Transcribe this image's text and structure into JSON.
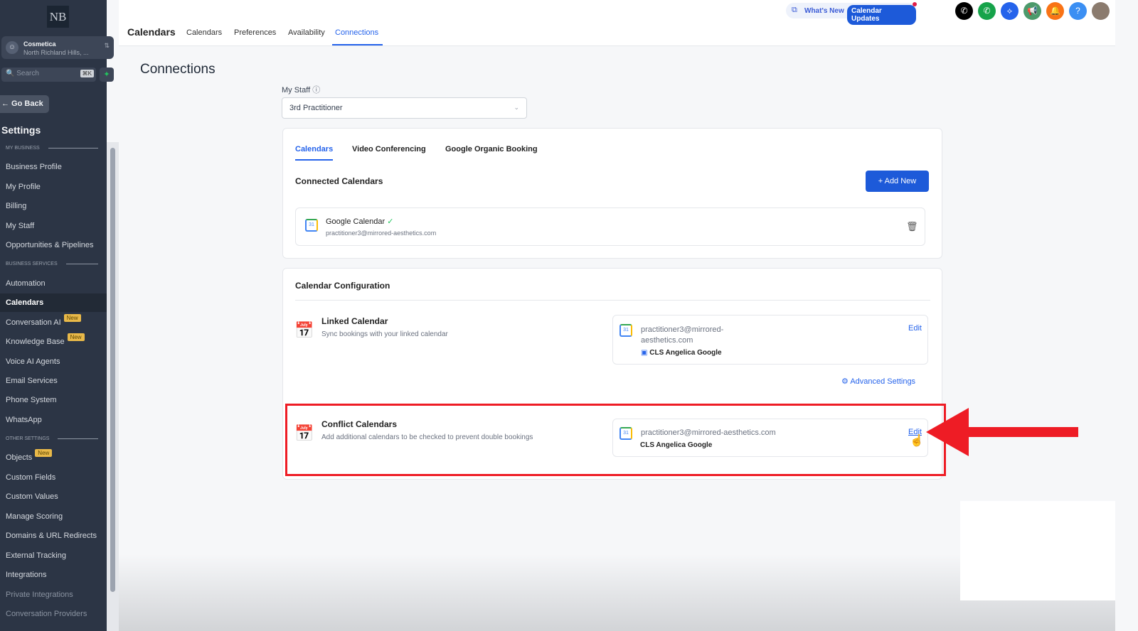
{
  "sidebar": {
    "logo": "NB",
    "account_name": "Cosmetica",
    "account_location": "North Richland Hills, ...",
    "search_placeholder": "Search",
    "search_shortcut": "⌘K",
    "go_back": "← Go Back",
    "settings_title": "Settings",
    "sections": {
      "my_business": "MY BUSINESS",
      "business_services": "BUSINESS SERVICES",
      "other_settings": "OTHER SETTINGS"
    },
    "items": [
      "Business Profile",
      "My Profile",
      "Billing",
      "My Staff",
      "Opportunities & Pipelines",
      "Automation",
      "Calendars",
      "Conversation AI",
      "Knowledge Base",
      "Voice AI Agents",
      "Email Services",
      "Phone System",
      "WhatsApp",
      "Objects",
      "Custom Fields",
      "Custom Values",
      "Manage Scoring",
      "Domains & URL Redirects",
      "External Tracking",
      "Integrations",
      "Private Integrations",
      "Conversation Providers"
    ],
    "new_badge": "New",
    "active_item": "Calendars"
  },
  "topbar": {
    "title": "Calendars",
    "tabs": [
      "Calendars",
      "Preferences",
      "Availability",
      "Connections"
    ],
    "active_tab": "Connections",
    "whats_new": "What's New",
    "calendar_updates": "Calendar Updates",
    "icons": [
      {
        "name": "phone-icon",
        "color": "#000000"
      },
      {
        "name": "call-icon",
        "color": "#16a34a"
      },
      {
        "name": "integration-icon",
        "color": "#2563eb"
      },
      {
        "name": "megaphone-icon",
        "color": "#4c9a6b"
      },
      {
        "name": "bell-icon",
        "color": "#f97316"
      },
      {
        "name": "help-icon",
        "color": "#3b8ff3"
      }
    ]
  },
  "main": {
    "title": "Connections",
    "staff_label": "My Staff",
    "staff_value": "3rd Practitioner",
    "tabs": [
      "Calendars",
      "Video Conferencing",
      "Google Organic Booking"
    ],
    "active_tab": "Calendars",
    "connected": {
      "title": "Connected Calendars",
      "add_new": "+ Add New",
      "calendar_name": "Google Calendar",
      "calendar_email": "practitioner3@mirrored-aesthetics.com"
    },
    "config": {
      "title": "Calendar Configuration",
      "linked": {
        "title": "Linked Calendar",
        "desc": "Sync bookings with your linked calendar",
        "email_line1": "practitioner3@mirrored-",
        "email_line2": "aesthetics.com",
        "calendar": "CLS Angelica Google",
        "edit": "Edit"
      },
      "advanced": "Advanced Settings",
      "conflict": {
        "title": "Conflict Calendars",
        "desc": "Add additional calendars to be checked to prevent double bookings",
        "email": "practitioner3@mirrored-aesthetics.com",
        "calendar": "CLS Angelica Google",
        "edit": "Edit"
      }
    }
  },
  "annotation_color": "#ee1c25",
  "accent": "#1d5ad9"
}
